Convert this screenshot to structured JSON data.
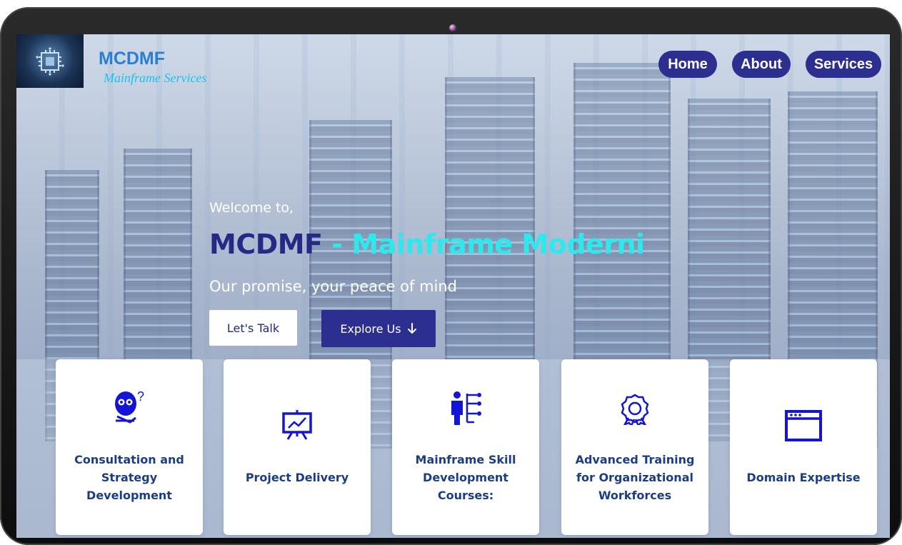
{
  "brand": {
    "title": "MCDMF",
    "subtitle": "Mainframe Services"
  },
  "nav": {
    "home": "Home",
    "about": "About",
    "services": "Services"
  },
  "hero": {
    "welcome": "Welcome to,",
    "title_part1": "MCDMF",
    "title_part2": " - Mainframe Moderni",
    "tagline": "Our promise, your peace of mind",
    "talk_button": "Let's Talk",
    "explore_button": "Explore Us"
  },
  "cards": [
    {
      "label": "Consultation and Strategy Development",
      "icon": "thinking-person-icon"
    },
    {
      "label": "Project Delivery",
      "icon": "presentation-board-icon"
    },
    {
      "label": "Mainframe Skill Development Courses:",
      "icon": "person-hierarchy-icon"
    },
    {
      "label": "Advanced Training for Organizational Workforces",
      "icon": "award-badge-icon"
    },
    {
      "label": "Domain Expertise",
      "icon": "browser-window-icon"
    }
  ],
  "colors": {
    "accent": "#2c2f8f",
    "brand_blue": "#2a7fd3",
    "cyan": "#2de9ee",
    "card_text": "#1b3d86",
    "icon_blue": "#1414d6"
  }
}
